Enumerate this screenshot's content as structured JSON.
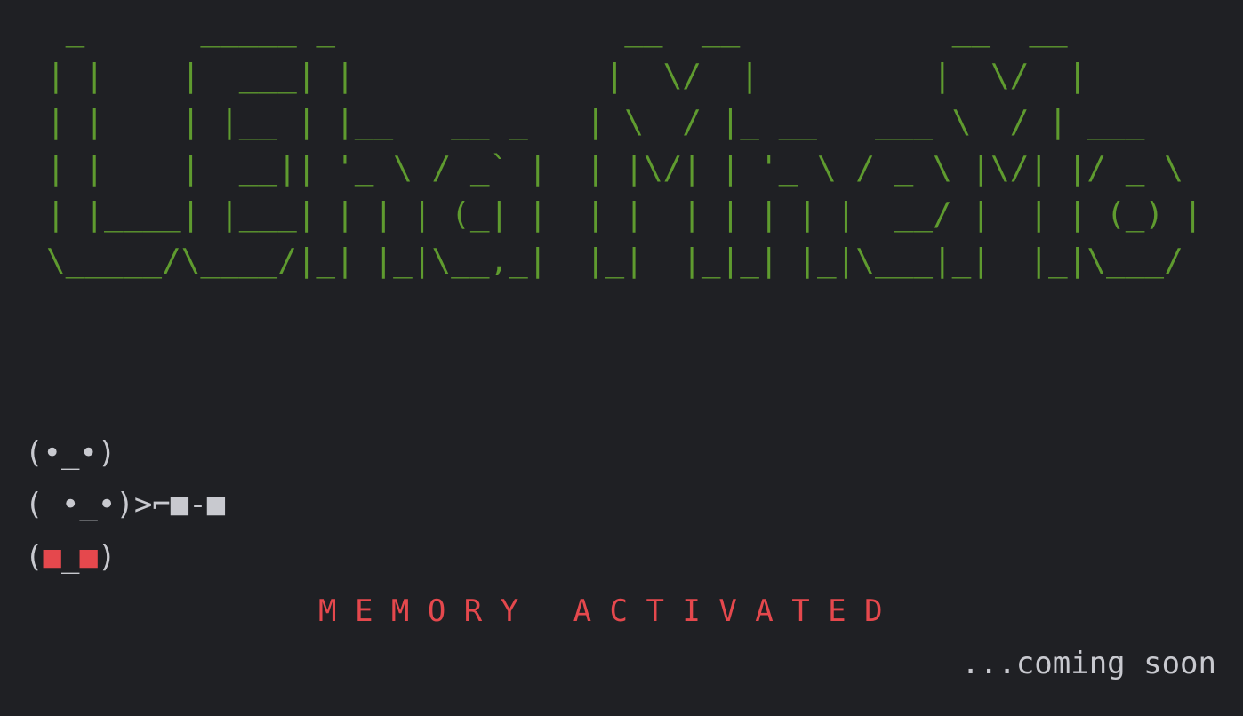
{
  "banner": {
    "lines": [
      " _      _____ _               __  __           __  __",
      "| |    |  ___| |             |  \\/  |         |  \\/  |",
      "| |    | |__ | |__   __ _   | \\  / |_ __   ___ \\  / | ___",
      "| |    |  __|| '_ \\ / _` |  | |\\/| | '_ \\ / _ \\ |\\/| |/ _ \\",
      "| |____| |___| | | | (_| |  | |  | | | | |  __/ |  | | (_) |",
      "\\_____/\\____/|_| |_|\\__,_|  |_|  |_|_| |_|\\___|_|  |_|\\___/"
    ]
  },
  "faces": {
    "line1": "(•_•)",
    "line2": "( •_•)>⌐■-■",
    "line3_open": "(",
    "line3_left": "■",
    "line3_mid": "_",
    "line3_right": "■",
    "line3_close": ")"
  },
  "status": {
    "memory": "M E M O R Y   A C T I V A T E D",
    "soon": "...coming soon"
  },
  "colors": {
    "background": "#1f2024",
    "banner": "#5f9b2f",
    "accent": "#e5484d",
    "text": "#c8c9cf"
  }
}
